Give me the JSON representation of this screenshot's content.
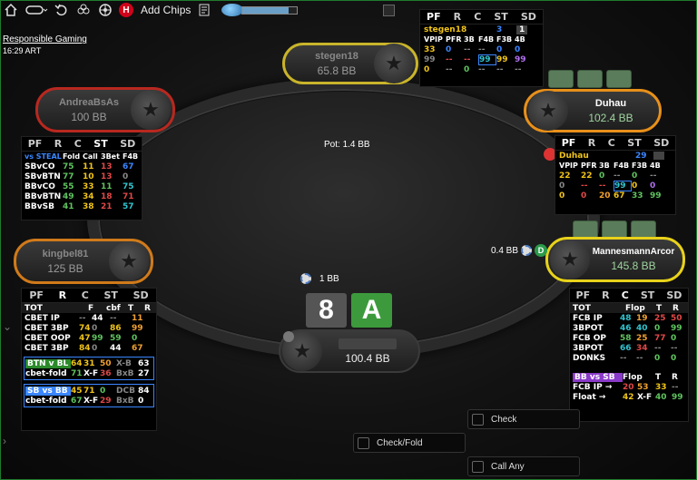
{
  "toolbar": {
    "add_chips": "Add Chips",
    "h_badge": "H",
    "progress": 0.85
  },
  "responsible_gaming": "Responsible Gaming",
  "clock": "16:29 ART",
  "pot": "Pot: 1.4 BB",
  "players": {
    "stegen18": {
      "name": "stegen18",
      "stack": "65.8 BB"
    },
    "andrea": {
      "name": "AndreaBsAs",
      "stack": "100 BB"
    },
    "duhau": {
      "name": "Duhau",
      "stack": "102.4 BB"
    },
    "kingbel": {
      "name": "kingbel81",
      "stack": "125 BB"
    },
    "mannesmann": {
      "name": "MannesmannArcor",
      "stack": "145.8 BB"
    },
    "hero": {
      "name": "",
      "stack": "100.4 BB"
    }
  },
  "bets": {
    "hero_bet": "1 BB",
    "hero_chip": "250",
    "mannesmann_bet": "0.4 BB",
    "mannesmann_chip": "50",
    "dealer_button": "D"
  },
  "hero_cards": [
    {
      "rank": "8",
      "color": "#555555"
    },
    {
      "rank": "A",
      "color": "#3c9a3c"
    }
  ],
  "hud_tabs": [
    "PF",
    "R",
    "C",
    "ST",
    "SD"
  ],
  "hud_stegen": {
    "name": "stegen18",
    "n1": "3",
    "n2": "1",
    "header": [
      "VPIP",
      "PFR",
      "3B",
      "F4B",
      "F3B",
      "4B"
    ],
    "r1": [
      "33",
      "0",
      "--",
      "--",
      "0",
      "0"
    ],
    "r2": [
      "99",
      "--",
      "--",
      "99",
      "99",
      "99"
    ],
    "r3": [
      "0",
      "--",
      "0",
      "--",
      "--",
      "--"
    ]
  },
  "hud_duhau": {
    "name": "Duhau",
    "n1": "29",
    "header": [
      "VPIP",
      "PFR",
      "3B",
      "F4B",
      "F3B",
      "4B"
    ],
    "r1": [
      "22",
      "22",
      "0",
      "--",
      "0",
      "--"
    ],
    "r2": [
      "0",
      "--",
      "--",
      "99",
      "0",
      "0"
    ],
    "r3": [
      "0",
      "0",
      "20",
      "67",
      "33",
      "99"
    ]
  },
  "hud_andrea": {
    "header": [
      "vs STEAL",
      "Fold",
      "Call",
      "3Bet",
      "F4B"
    ],
    "rows": [
      [
        "SBvCO",
        "75",
        "11",
        "13",
        "67"
      ],
      [
        "SBvBTN",
        "77",
        "10",
        "13",
        "0"
      ],
      [
        "BBvCO",
        "55",
        "33",
        "11",
        "75"
      ],
      [
        "BBvBTN",
        "49",
        "34",
        "18",
        "71"
      ],
      [
        "BBvSB",
        "41",
        "38",
        "21",
        "57"
      ]
    ]
  },
  "hud_kingbel": {
    "tot": "TOT",
    "header": [
      "F",
      "cbf",
      "T",
      "R"
    ],
    "rows": [
      [
        "CBET IP",
        "--",
        "44",
        "--",
        "11"
      ],
      [
        "CBET 3BP",
        "74",
        "0",
        "86",
        "99"
      ],
      [
        "CBET OOP",
        "47",
        "99",
        "59",
        "0"
      ],
      [
        "CBET 3BP",
        "84",
        "0",
        "44",
        "67"
      ]
    ],
    "btn_box": {
      "title": "BTN v BL",
      "v1": "64",
      "v2": "31",
      "v3": "50",
      "xb": "X-B",
      "xbv": "63",
      "sub": "cbet-fold",
      "s1": "71",
      "xf": "X-F",
      "xfv": "36",
      "bxb": "BxB",
      "bxbv": "27"
    },
    "sb_box": {
      "title": "SB vs BB",
      "v1": "45",
      "v2": "71",
      "v3": "0",
      "dcb": "DCB",
      "dcbv": "84",
      "sub": "cbet-fold",
      "s1": "67",
      "xf": "X-F",
      "xfv": "29",
      "bxb": "BxB",
      "bxbv": "0"
    }
  },
  "hud_mannesmann": {
    "tot": "TOT",
    "header": [
      "Flop",
      "T",
      "R"
    ],
    "rows": [
      [
        "FCB IP",
        "48",
        "19",
        "25",
        "50"
      ],
      [
        "3BPOT",
        "46",
        "40",
        "0",
        "99"
      ],
      [
        "FCB OP",
        "58",
        "25",
        "77",
        "0"
      ],
      [
        "3BPOT",
        "66",
        "34",
        "--",
        "--"
      ],
      [
        "DONKS",
        "--",
        "--",
        "0",
        "0"
      ]
    ],
    "bb_box": {
      "title": "BB vs SB",
      "h1": "Flop",
      "h2": "T",
      "h3": "R",
      "r1": [
        "FCB IP →",
        "20",
        "53",
        "33",
        "--"
      ],
      "r2": [
        "Float →",
        "42",
        "X-F",
        "40",
        "99"
      ]
    }
  },
  "actions": {
    "check": "Check",
    "check_fold": "Check/Fold",
    "call_any": "Call Any"
  }
}
